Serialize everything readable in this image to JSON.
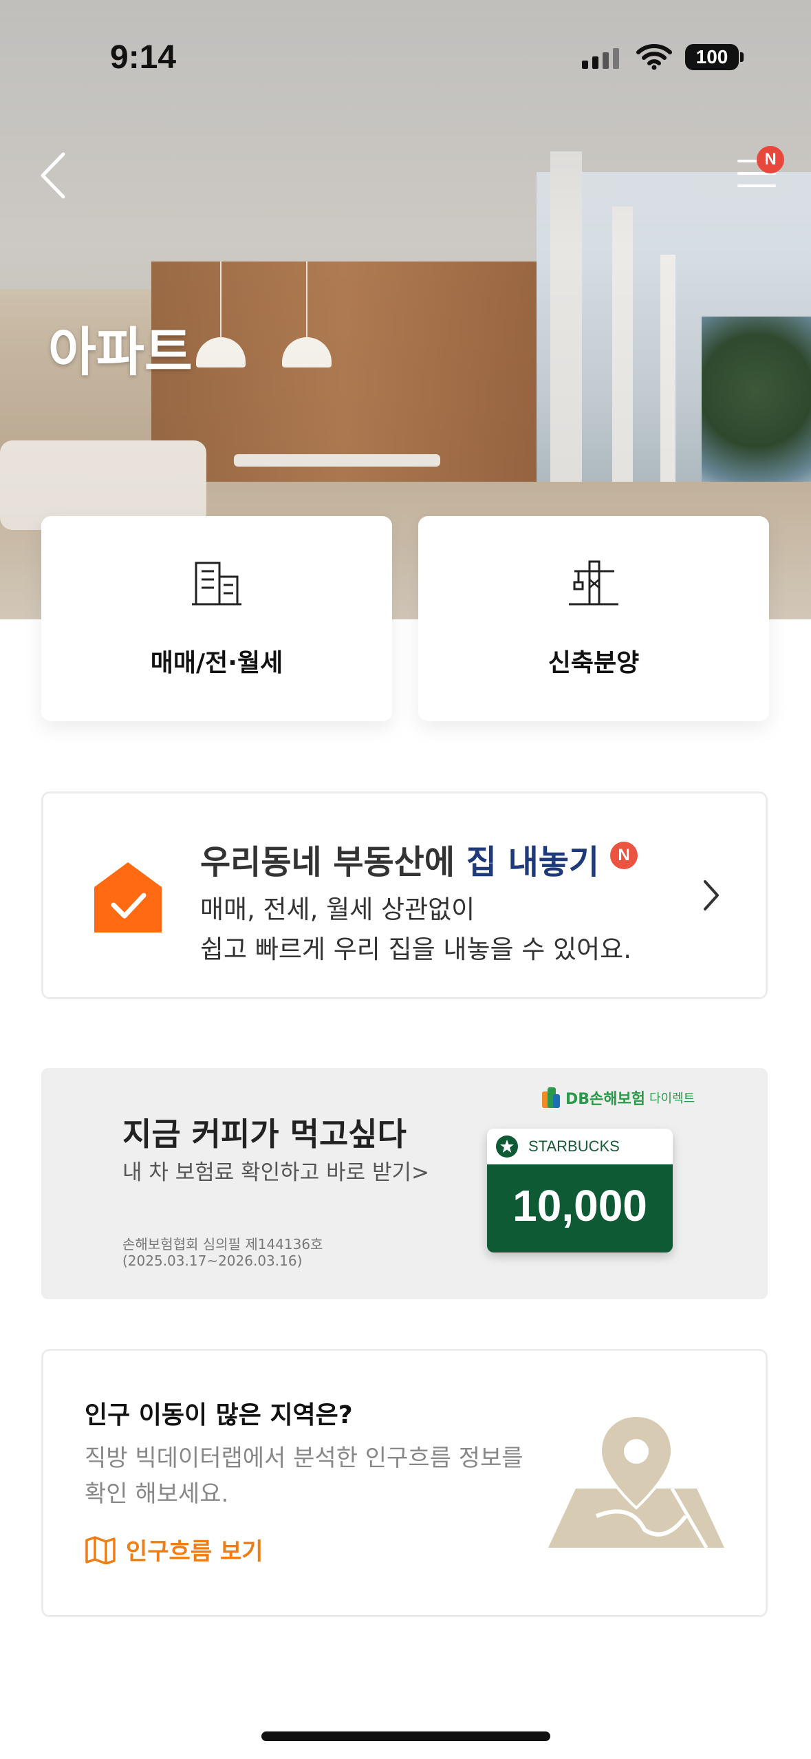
{
  "status_bar": {
    "time": "9:14",
    "battery": "100"
  },
  "header": {
    "title": "아파트",
    "menu_badge": "N"
  },
  "categories": [
    {
      "label": "매매/전·월세",
      "icon": "building-icon"
    },
    {
      "label": "신축분양",
      "icon": "crane-icon"
    }
  ],
  "listing_banner": {
    "title_prefix": "우리동네 부동산에 ",
    "title_highlight": "집 내놓기",
    "badge": "N",
    "line1": "매매, 전세, 월세 상관없이",
    "line2": "쉽고 빠르게 우리 집을 내놓을 수 있어요.",
    "accent_color": "#ff6a13"
  },
  "ad_banner": {
    "title": "지금 커피가 먹고싶다",
    "subtitle": "내 차 보험료 확인하고 바로 받기>",
    "fine_print_1": "손해보험협회 심의필 제144136호",
    "fine_print_2": "(2025.03.17~2026.03.16)",
    "brand_main": "DB손해보험",
    "brand_sub": "다이렉트",
    "coupon_brand": "STARBUCKS",
    "coupon_amount": "10,000"
  },
  "population_card": {
    "title": "인구 이동이 많은 지역은?",
    "desc_line1": "직방 빅데이터랩에서 분석한 인구흐름 정보를",
    "desc_line2": "확인 해보세요.",
    "link_label": "인구흐름 보기",
    "link_color": "#ef7d12"
  }
}
